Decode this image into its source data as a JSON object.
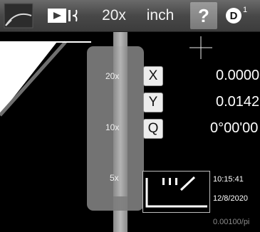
{
  "toolbar": {
    "icons": [
      "arc-tool-icon",
      "record-video-icon"
    ],
    "zoom_label": "20x",
    "unit_label": "inch",
    "help_label": "?",
    "d_badge": "D",
    "d_superscript": "1"
  },
  "zoom_slider": {
    "levels": [
      "20x",
      "10x",
      "5x"
    ]
  },
  "coordinates": {
    "x": {
      "label": "X",
      "value": "0.0000"
    },
    "y": {
      "label": "Y",
      "value": "0.0142"
    },
    "q": {
      "label": "Q",
      "value": "0°00'00"
    }
  },
  "info": {
    "time": "10:15:41",
    "date": "12/8/2020",
    "scale": "0.00100/pi"
  }
}
